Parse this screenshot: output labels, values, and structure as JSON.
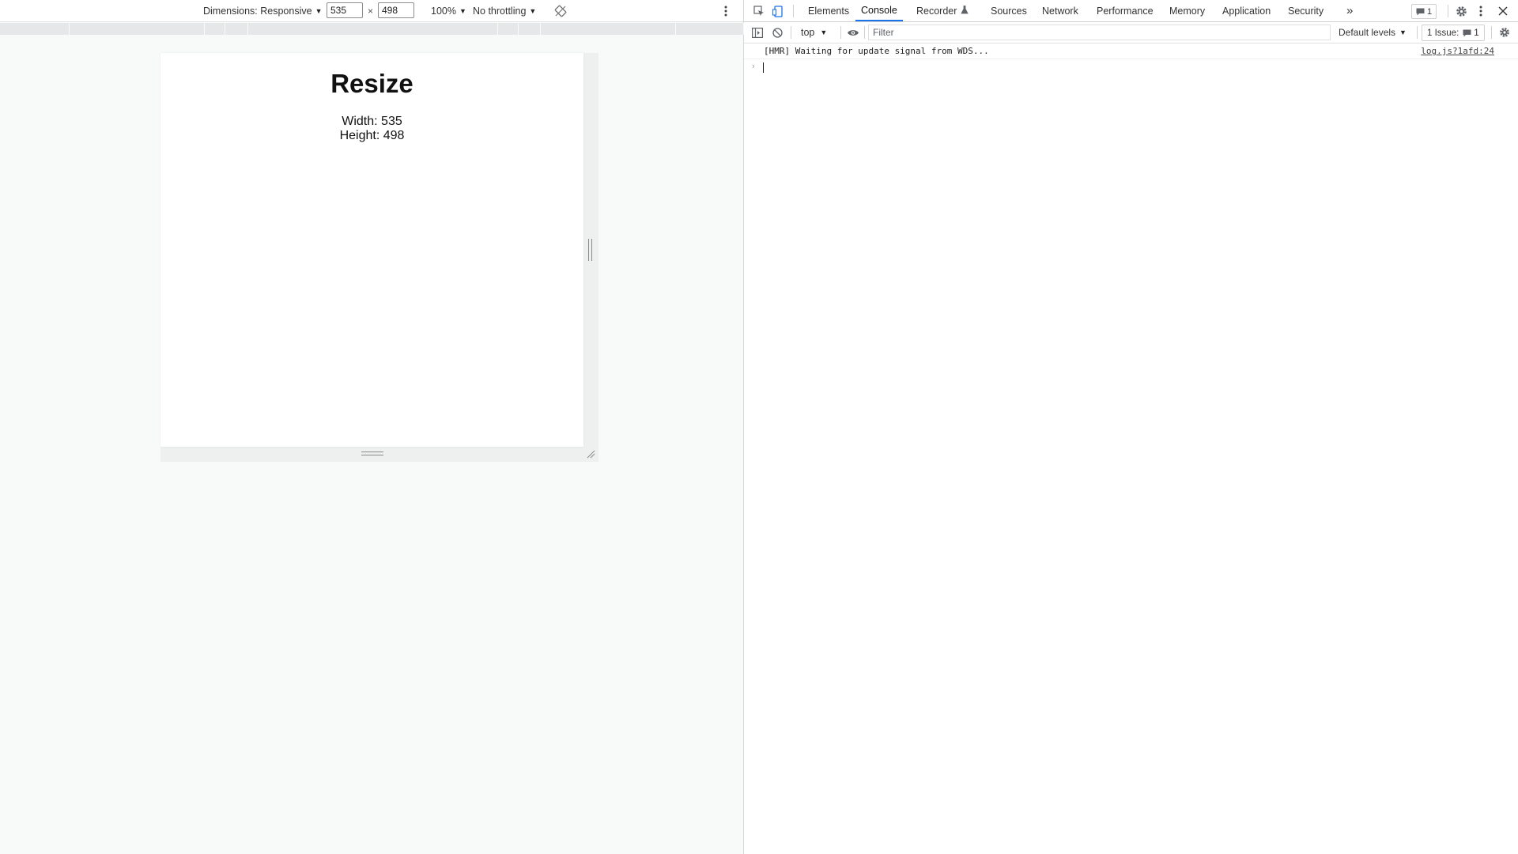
{
  "device_toolbar": {
    "dimensions_label": "Dimensions: Responsive",
    "width_value": "535",
    "times": "×",
    "height_value": "498",
    "zoom": "100%",
    "throttling": "No throttling"
  },
  "page": {
    "heading": "Resize",
    "width_line": "Width: 535",
    "height_line": "Height: 498"
  },
  "devtools": {
    "tabs": [
      "Elements",
      "Console",
      "Recorder",
      "Sources",
      "Network",
      "Performance",
      "Memory",
      "Application",
      "Security"
    ],
    "active_tab": "Console",
    "overflow": "»",
    "message_badge_count": "1"
  },
  "console_toolbar": {
    "context": "top",
    "filter_placeholder": "Filter",
    "levels": "Default levels",
    "issues_label": "1 Issue:",
    "issues_count": "1"
  },
  "console": {
    "messages": [
      {
        "text": "[HMR] Waiting for update signal from WDS...",
        "source": "log.js?1afd:24"
      }
    ],
    "prompt": "›"
  }
}
